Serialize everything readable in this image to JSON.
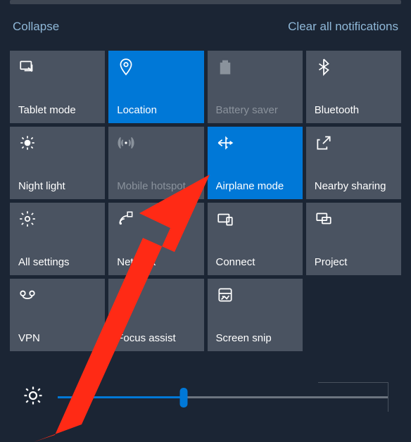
{
  "header": {
    "collapse_label": "Collapse",
    "clear_label": "Clear all notifications"
  },
  "tiles": [
    {
      "id": "tablet-mode",
      "label": "Tablet mode",
      "icon": "tablet-icon",
      "active": false
    },
    {
      "id": "location",
      "label": "Location",
      "icon": "location-icon",
      "active": true
    },
    {
      "id": "battery-saver",
      "label": "Battery saver",
      "icon": "battery-icon",
      "active": false,
      "dim": true
    },
    {
      "id": "bluetooth",
      "label": "Bluetooth",
      "icon": "bluetooth-icon",
      "active": false
    },
    {
      "id": "night-light",
      "label": "Night light",
      "icon": "nightlight-icon",
      "active": false
    },
    {
      "id": "mobile-hotspot",
      "label": "Mobile hotspot",
      "icon": "hotspot-icon",
      "active": false,
      "dim": true
    },
    {
      "id": "airplane-mode",
      "label": "Airplane mode",
      "icon": "airplane-icon",
      "active": true
    },
    {
      "id": "nearby-sharing",
      "label": "Nearby sharing",
      "icon": "share-icon",
      "active": false
    },
    {
      "id": "all-settings",
      "label": "All settings",
      "icon": "settings-icon",
      "active": false
    },
    {
      "id": "network",
      "label": "Network",
      "icon": "network-icon",
      "active": false
    },
    {
      "id": "connect",
      "label": "Connect",
      "icon": "connect-icon",
      "active": false
    },
    {
      "id": "project",
      "label": "Project",
      "icon": "project-icon",
      "active": false
    },
    {
      "id": "vpn",
      "label": "VPN",
      "icon": "vpn-icon",
      "active": false
    },
    {
      "id": "focus-assist",
      "label": "Focus assist",
      "icon": "moon-icon",
      "active": false
    },
    {
      "id": "screen-snip",
      "label": "Screen snip",
      "icon": "snip-icon",
      "active": false
    }
  ],
  "brightness": {
    "value": 38,
    "min": 0,
    "max": 100
  },
  "colors": {
    "accent": "#0078d7",
    "tile": "#4a5361",
    "bg": "#1b2534",
    "link": "#8fb8d8",
    "arrow": "#ff2a15"
  },
  "annotation": {
    "arrow_target": "airplane-mode"
  }
}
